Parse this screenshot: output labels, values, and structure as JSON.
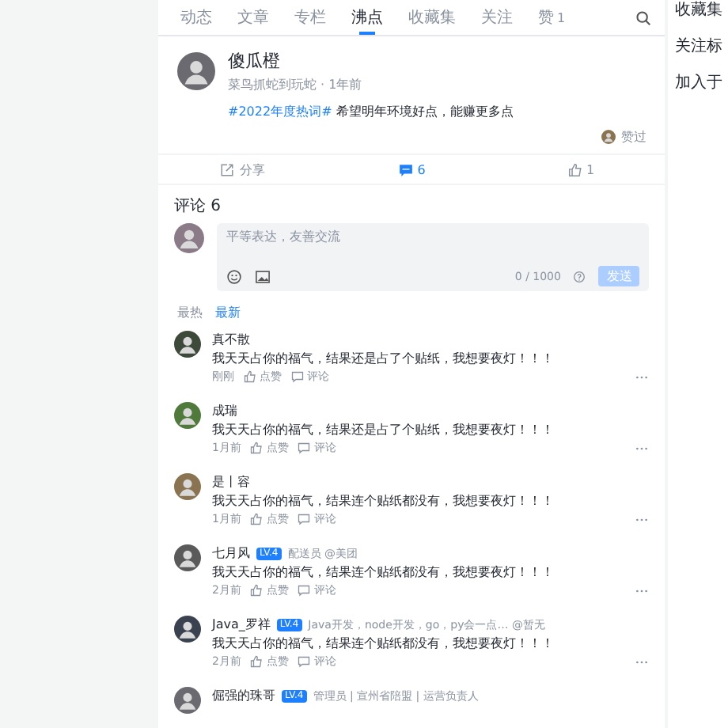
{
  "tabs": [
    {
      "label": "动态",
      "selected": false
    },
    {
      "label": "文章",
      "selected": false
    },
    {
      "label": "专栏",
      "selected": false
    },
    {
      "label": "沸点",
      "selected": true
    },
    {
      "label": "收藏集",
      "selected": false
    },
    {
      "label": "关注",
      "selected": false
    },
    {
      "label": "赞",
      "count": "1",
      "selected": false
    }
  ],
  "side_panel": {
    "items": [
      "收藏集",
      "关注标",
      "加入于"
    ]
  },
  "post": {
    "author": "傻瓜橙",
    "subtitle": "菜鸟抓蛇到玩蛇 · 1年前",
    "topic": "#2022年度热词#",
    "content": "希望明年环境好点，能赚更多点",
    "liked_by": "赞过",
    "actions": [
      {
        "kind": "share",
        "label": "分享",
        "active": false
      },
      {
        "kind": "comment",
        "label": "6",
        "active": true
      },
      {
        "kind": "like",
        "label": "1",
        "active": false
      }
    ]
  },
  "comments_header": "评论 6",
  "comment_input": {
    "placeholder": "平等表达，友善交流",
    "counter": "0 / 1000",
    "submit": "发送"
  },
  "sort": [
    {
      "label": "最热",
      "selected": false
    },
    {
      "label": "最新",
      "selected": true
    }
  ],
  "comments": [
    {
      "name": "真不散",
      "text": "我天天占你的福气，结果还是占了个贴纸，我想要夜灯！！！",
      "time": "刚刚",
      "like": "点赞",
      "reply": "评论"
    },
    {
      "name": "成瑞",
      "text": "我天天占你的福气，结果还是占了个贴纸，我想要夜灯！！！",
      "time": "1月前",
      "like": "点赞",
      "reply": "评论"
    },
    {
      "name": "是丨容",
      "text": "我天天占你的福气，结果连个贴纸都没有，我想要夜灯！！！",
      "time": "1月前",
      "like": "点赞",
      "reply": "评论"
    },
    {
      "name": "七月风",
      "badge": "LV.4",
      "info": "配送员 @美团",
      "text": "我天天占你的福气，结果连个贴纸都没有，我想要夜灯！！！",
      "time": "2月前",
      "like": "点赞",
      "reply": "评论"
    },
    {
      "name": "Java_罗祥",
      "badge": "LV.4",
      "info": "Java开发，node开发，go，py会一点… @暂无",
      "text": "我天天占你的福气，结果连个贴纸都没有，我想要夜灯！！！",
      "time": "2月前",
      "like": "点赞",
      "reply": "评论"
    },
    {
      "name": "倔强的珠哥",
      "badge": "LV.4",
      "info": "管理员 | 宣州省陪盟 | 运营负责人"
    }
  ]
}
